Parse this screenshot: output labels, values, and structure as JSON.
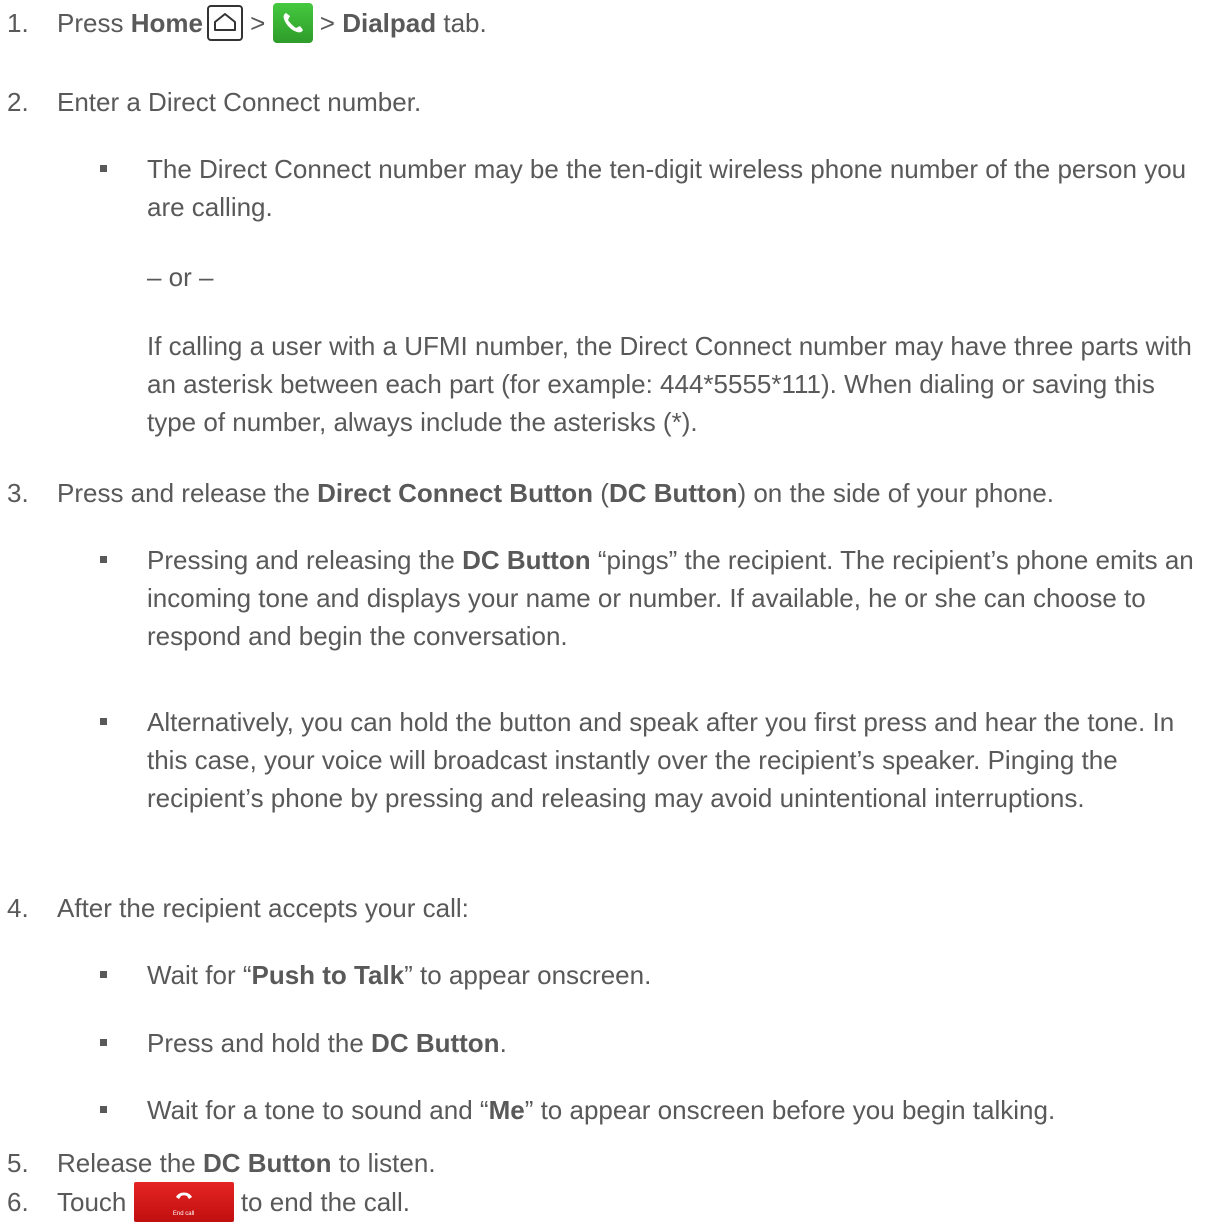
{
  "steps": [
    {
      "num": "1.",
      "parts": [
        "Press ",
        "Home",
        " > ",
        " > ",
        "Dialpad",
        " tab."
      ]
    },
    {
      "num": "2.",
      "text": "Enter a Direct Connect number.",
      "bullet": "The Direct Connect number may be the ten-digit wireless phone number of the person you are calling.",
      "or": "– or –",
      "para": "If calling a user with a UFMI number, the Direct Connect number may have three parts with an asterisk between each part (for example: 444*5555*111). When dialing or saving this type of number, always include the asterisks (*)."
    },
    {
      "num": "3.",
      "parts": [
        "Press and release the ",
        "Direct Connect Button",
        " (",
        "DC Button",
        ") on the side of your phone."
      ],
      "bullet1_parts": [
        "Pressing and releasing the ",
        "DC Button",
        " “pings” the recipient. The recipient’s phone emits an incoming tone and displays your name or number. If available, he or she can choose to respond and begin the conversation."
      ],
      "bullet2": "Alternatively, you can hold the button and speak after you first press and hear the tone. In this case, your voice will broadcast instantly over the recipient’s speaker. Pinging the recipient’s phone by pressing and releasing may avoid unintentional interruptions."
    },
    {
      "num": "4.",
      "text": "After the recipient accepts your call:",
      "b1": [
        "Wait for “",
        "Push to Talk",
        "” to appear onscreen."
      ],
      "b2": [
        "Press and hold the ",
        "DC Button",
        "."
      ],
      "b3": [
        "Wait for a tone to sound and “",
        "Me",
        "” to appear onscreen before you begin talking."
      ]
    },
    {
      "num": "5.",
      "parts": [
        "Release the ",
        "DC Button",
        " to listen."
      ]
    },
    {
      "num": "6.",
      "parts": [
        "Touch ",
        " to end the call."
      ],
      "end_call_label": "End call"
    }
  ],
  "icons": {
    "home": "home-icon",
    "phone": "phone-app-icon",
    "end_call": "end-call-button-icon"
  }
}
